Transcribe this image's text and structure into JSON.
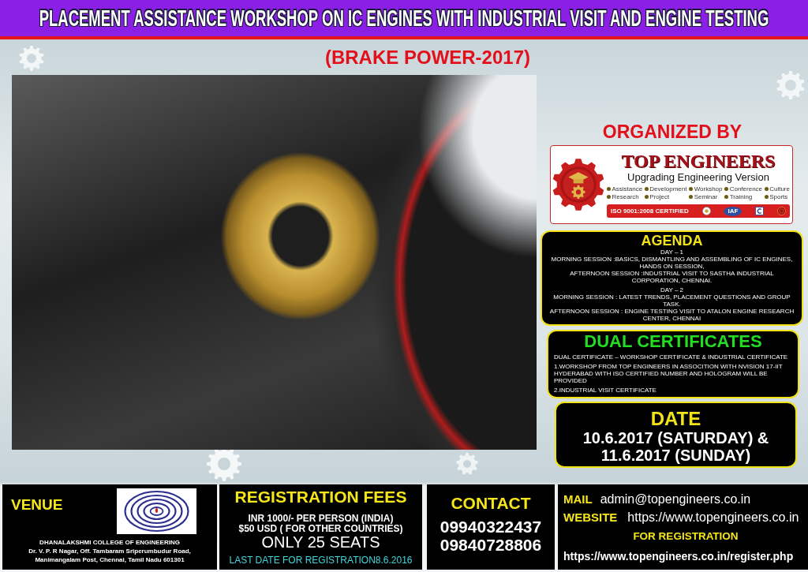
{
  "banner": {
    "title": "PLACEMENT ASSISTANCE WORKSHOP ON IC ENGINES WITH INDUSTRIAL VISIT AND ENGINE TESTING",
    "subtitle": "(BRAKE POWER-2017)"
  },
  "organizer": {
    "heading": "ORGANIZED BY",
    "name": "TOP ENGINEERS",
    "tagline": "Upgrading Engineering Version",
    "services": [
      "Assistance",
      "Development",
      "Workshop",
      "Conference",
      "Culture",
      "Research",
      "Project",
      "Seminar",
      "Training",
      "Sports"
    ],
    "certification": "ISO 9001:2008 CERTIFIED",
    "badges": [
      {
        "kind": "seal"
      },
      {
        "kind": "oval",
        "label": "IAF"
      },
      {
        "kind": "square"
      },
      {
        "kind": "ring"
      }
    ]
  },
  "agenda": {
    "heading": "AGENDA",
    "days": [
      {
        "label": "DAY – 1",
        "lines": [
          "MORNING SESSION :BASICS, DISMANTLING AND ASSEMBLING OF IC ENGINES, HANDS ON SESSION,",
          "AFTERNOON SESSION :INDUSTRIAL VISIT TO SASTHA INDUSTRIAL CORPORATION, CHENNAI."
        ]
      },
      {
        "label": "DAY – 2",
        "lines": [
          "MORNING SESSION : LATEST TRENDS, PLACEMENT QUESTIONS AND GROUP TASK.",
          "AFTERNOON SESSION : ENGINE TESTING VISIT TO ATALON ENGINE RESEARCH CENTER, CHENNAI"
        ]
      }
    ]
  },
  "certificates": {
    "heading": "DUAL CERTIFICATES",
    "paragraphs": [
      "DUAL CERTIFICATE – WORKSHOP CERTIFICATE & INDUSTRIAL CERTIFICATE",
      "1.WORKSHOP FROM TOP ENGINEERS IN ASSOCITION WITH NVISION 17-IIT HYDERABAD WITH ISO CERTIFIED NUMBER AND HOLOGRAM WILL BE PROVIDED",
      "2.INDUSTRIAL VISIT CERTIFICATE"
    ]
  },
  "date": {
    "heading": "DATE",
    "lines": [
      "10.6.2017 (SATURDAY) &",
      "11.6.2017 (SUNDAY)"
    ]
  },
  "footer": {
    "venue": {
      "heading": "VENUE",
      "lines": [
        "DHANALAKSHMI COLLEGE OF ENGINEERING",
        "Dr. V. P. R Nagar, Off. Tambaram Sriperumbudur Road,",
        "Manimangalam Post, Chennai, Tamil Nadu 601301"
      ]
    },
    "fees": {
      "heading": "REGISTRATION FEES",
      "lines": [
        "INR 1000/- PER PERSON (INDIA)",
        "$50 USD ( FOR OTHER COUNTRIES)"
      ],
      "seats": "ONLY 25 SEATS",
      "deadline": "LAST DATE FOR REGISTRATION8.6.2016"
    },
    "contact": {
      "heading": "CONTACT",
      "phones": [
        "09940322437",
        "09840728806"
      ]
    },
    "online": {
      "mail": {
        "label": "MAIL",
        "value": "admin@topengineers.co.in"
      },
      "website": {
        "label": "WEBSITE",
        "value": "https://www.topengineers.co.in"
      },
      "registration": {
        "label": "FOR REGISTRATION",
        "value": "https://www.topengineers.co.in/register.php"
      }
    }
  }
}
